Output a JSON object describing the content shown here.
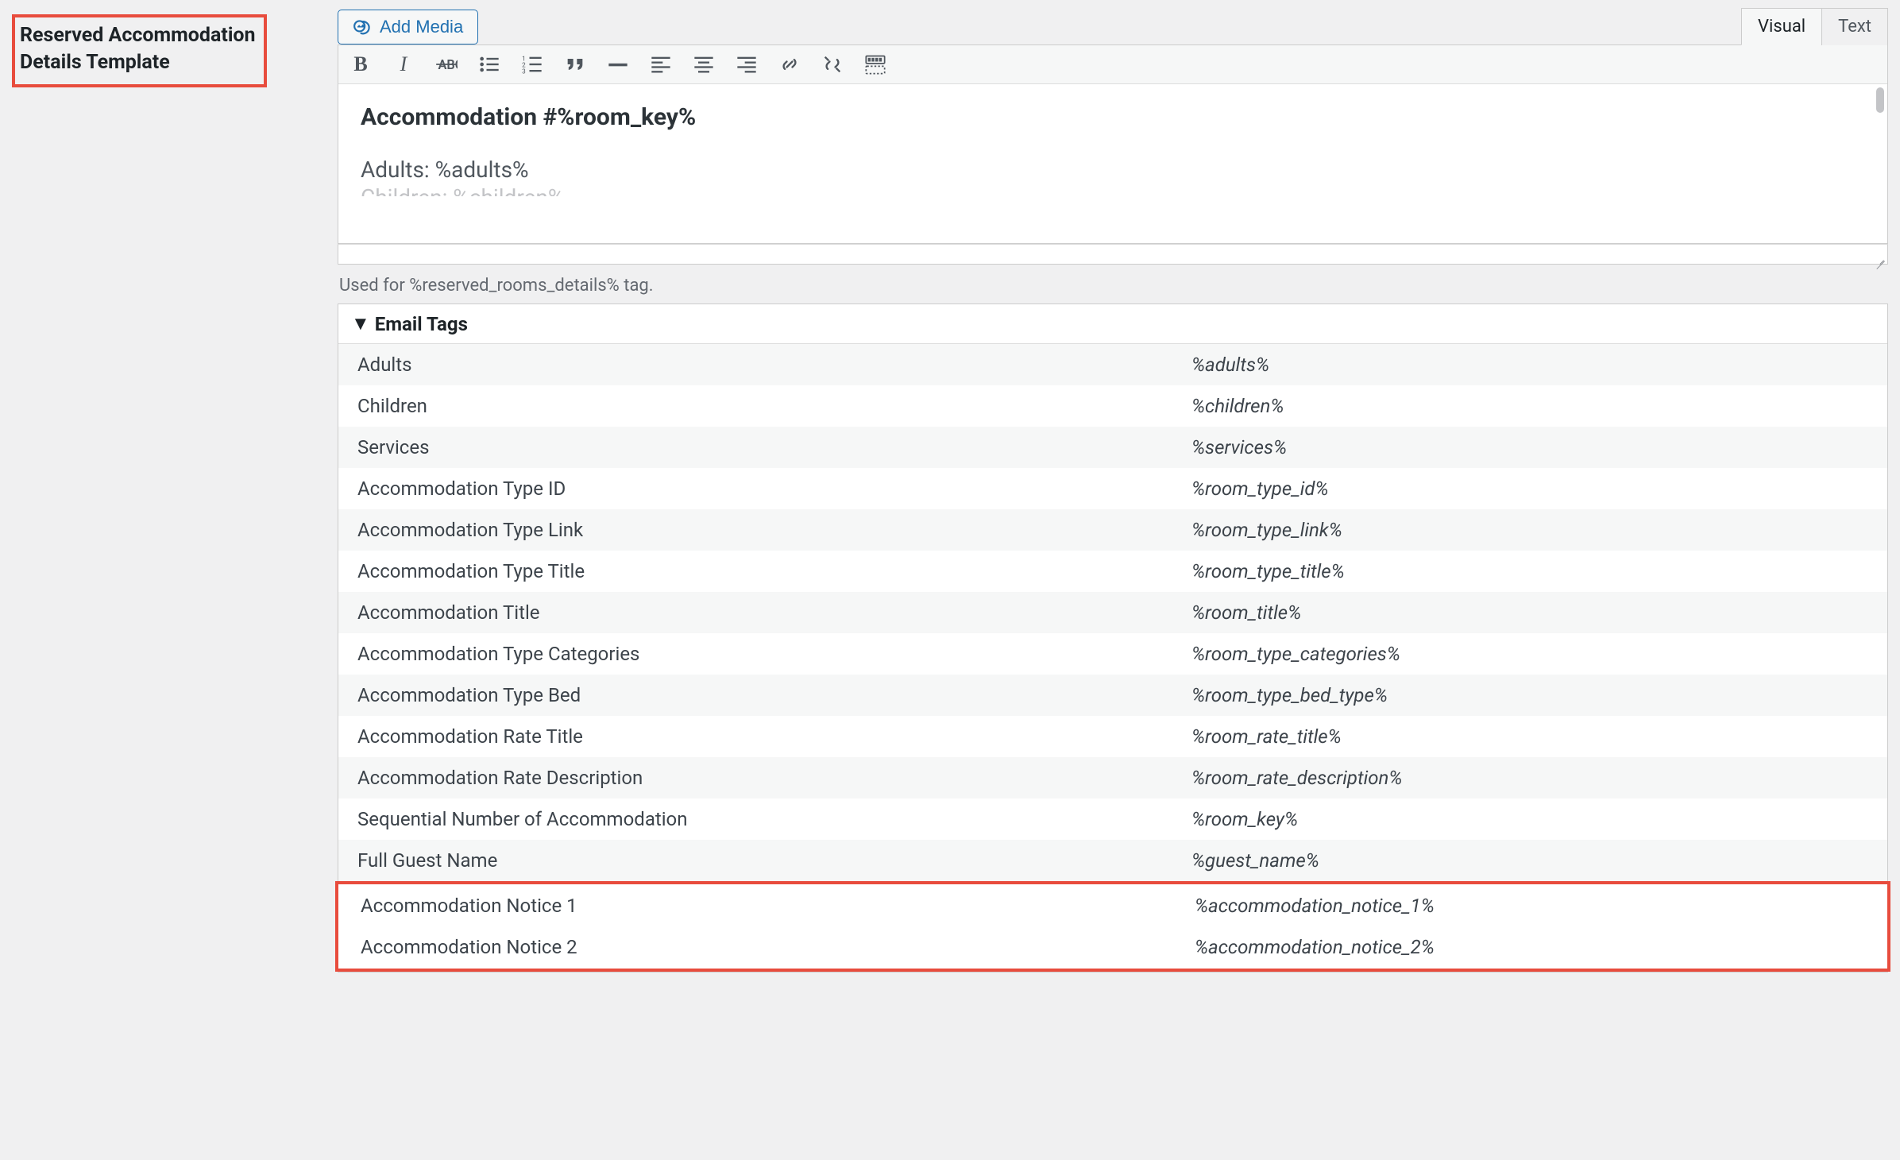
{
  "left_label_line1": "Reserved Accommodation",
  "left_label_line2": "Details Template",
  "add_media": "Add Media",
  "tabs": {
    "visual": "Visual",
    "text": "Text"
  },
  "editor": {
    "heading": "Accommodation #%room_key%",
    "line1": "Adults: %adults%",
    "line2": "Children: %children%"
  },
  "helper": "Used for %reserved_rooms_details% tag.",
  "tags_header": "Email Tags",
  "rows": [
    {
      "label": "Adults",
      "value": "%adults%"
    },
    {
      "label": "Children",
      "value": "%children%"
    },
    {
      "label": "Services",
      "value": "%services%"
    },
    {
      "label": "Accommodation Type ID",
      "value": "%room_type_id%"
    },
    {
      "label": "Accommodation Type Link",
      "value": "%room_type_link%"
    },
    {
      "label": "Accommodation Type Title",
      "value": "%room_type_title%"
    },
    {
      "label": "Accommodation Title",
      "value": "%room_title%"
    },
    {
      "label": "Accommodation Type Categories",
      "value": "%room_type_categories%"
    },
    {
      "label": "Accommodation Type Bed",
      "value": "%room_type_bed_type%"
    },
    {
      "label": "Accommodation Rate Title",
      "value": "%room_rate_title%"
    },
    {
      "label": "Accommodation Rate Description",
      "value": "%room_rate_description%"
    },
    {
      "label": "Sequential Number of Accommodation",
      "value": "%room_key%"
    },
    {
      "label": "Full Guest Name",
      "value": "%guest_name%"
    },
    {
      "label": "Accommodation Notice 1",
      "value": "%accommodation_notice_1%"
    },
    {
      "label": "Accommodation Notice 2",
      "value": "%accommodation_notice_2%"
    }
  ]
}
